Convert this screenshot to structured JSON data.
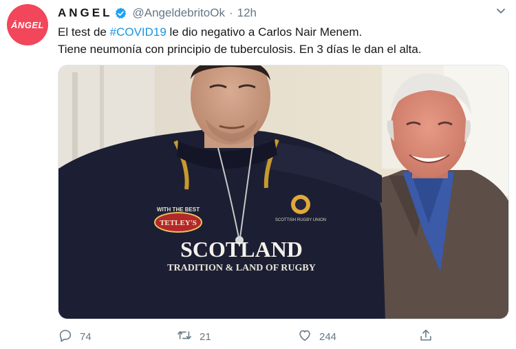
{
  "tweet": {
    "avatar_text": "ÁNGEL",
    "display_name": "ANGEL",
    "handle": "@AngeldebritoOk",
    "separator": "·",
    "time": "12h",
    "text_line1_prefix": "El test de ",
    "hashtag": "#COVID19",
    "text_line1_suffix": " le dio negativo a Carlos Nair Menem.",
    "text_line2": "Tiene neumonía con principio de tuberculosis. En 3 días le dan el alta.",
    "photo": {
      "shirt_badge_text": "WITH THE BEST",
      "shirt_badge_brand": "TETLEY'S",
      "shirt_main_text": "SCOTLAND",
      "shirt_sub_text": "TRADITION & LAND OF RUGBY",
      "shirt_crest_text": "SCOTTISH RUGBY UNION"
    },
    "replies": "74",
    "retweets": "21",
    "likes": "244"
  },
  "colors": {
    "avatar_bg": "#f2465a",
    "hashtag": "#1b95e0",
    "verified": "#1da1f2",
    "muted": "#657786"
  },
  "icons": [
    "verified-badge-icon",
    "chevron-down-icon",
    "reply-icon",
    "retweet-icon",
    "like-icon",
    "share-icon"
  ]
}
